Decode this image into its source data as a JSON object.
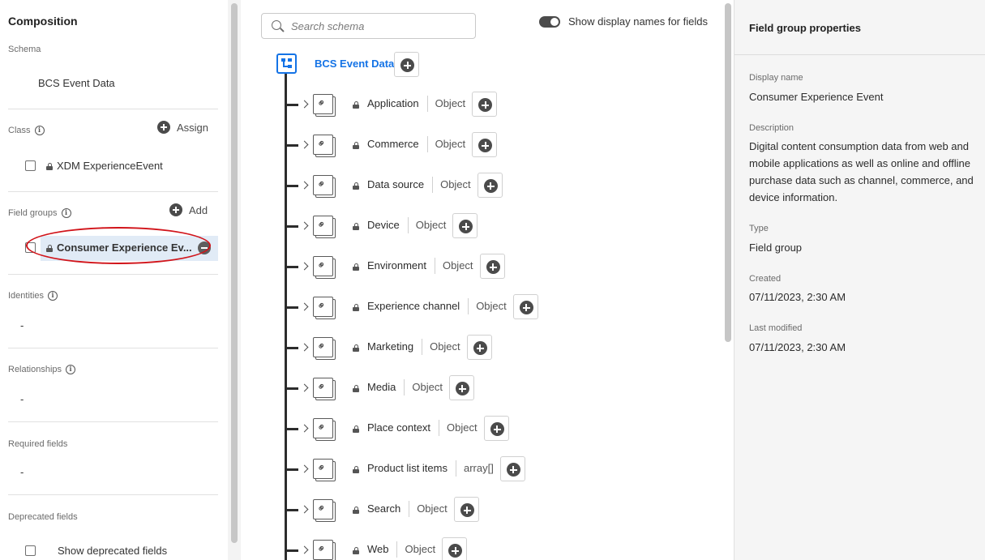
{
  "left": {
    "title": "Composition",
    "schema_label": "Schema",
    "schema_value": "BCS Event Data",
    "class_label": "Class",
    "assign_label": "Assign",
    "class_value": "XDM ExperienceEvent",
    "field_groups_label": "Field groups",
    "add_label": "Add",
    "field_group_selected": "Consumer Experience Ev...",
    "identities_label": "Identities",
    "identities_value": "-",
    "relationships_label": "Relationships",
    "relationships_value": "-",
    "required_label": "Required fields",
    "required_value": "-",
    "deprecated_label": "Deprecated fields",
    "show_deprecated_label": "Show deprecated fields"
  },
  "center": {
    "search_placeholder": "Search schema",
    "toggle_label": "Show display names for fields",
    "toggle_on": true,
    "root_title": "BCS Event Data",
    "fields": [
      {
        "name": "Application",
        "type": "Object"
      },
      {
        "name": "Commerce",
        "type": "Object"
      },
      {
        "name": "Data source",
        "type": "Object"
      },
      {
        "name": "Device",
        "type": "Object"
      },
      {
        "name": "Environment",
        "type": "Object"
      },
      {
        "name": "Experience channel",
        "type": "Object"
      },
      {
        "name": "Marketing",
        "type": "Object"
      },
      {
        "name": "Media",
        "type": "Object"
      },
      {
        "name": "Place context",
        "type": "Object"
      },
      {
        "name": "Product list items",
        "type": "array[]"
      },
      {
        "name": "Search",
        "type": "Object"
      },
      {
        "name": "Web",
        "type": "Object"
      }
    ]
  },
  "right": {
    "title": "Field group properties",
    "display_name_label": "Display name",
    "display_name_value": "Consumer Experience Event",
    "description_label": "Description",
    "description_value": "Digital content consumption data from web and mobile applications as well as online and offline purchase data such as channel, commerce, and device information.",
    "type_label": "Type",
    "type_value": "Field group",
    "created_label": "Created",
    "created_value": "07/11/2023, 2:30 AM",
    "modified_label": "Last modified",
    "modified_value": "07/11/2023, 2:30 AM"
  },
  "colors": {
    "accent": "#1473e6",
    "selected_bg": "#e1ebf6",
    "highlight_ellipse": "#d1141a"
  }
}
